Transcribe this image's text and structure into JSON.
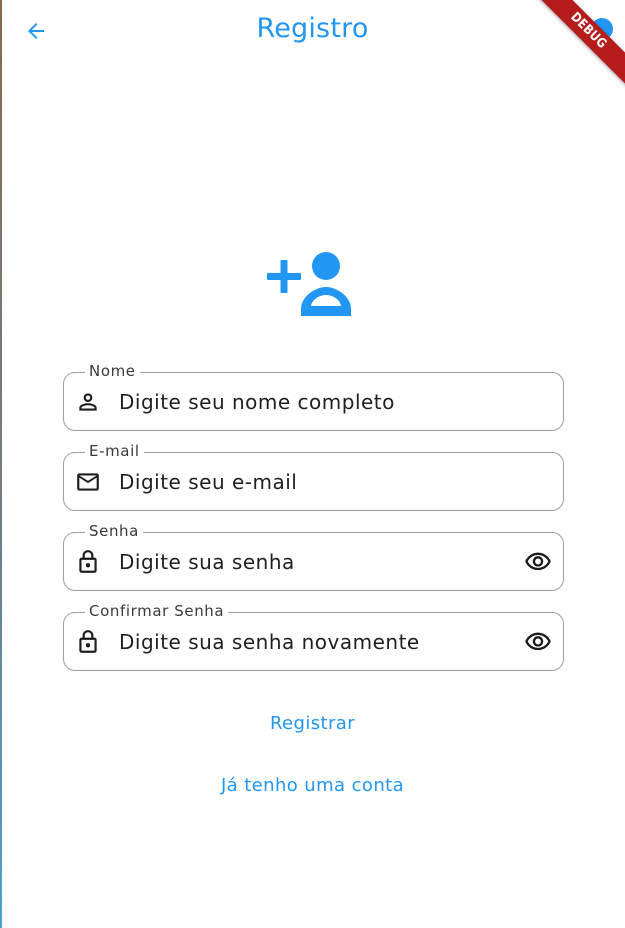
{
  "appbar": {
    "title": "Registro",
    "back_icon": "arrow-back-icon"
  },
  "debug_banner": "DEBUG",
  "hero_icon": "person-add-icon",
  "form": {
    "fields": [
      {
        "label": "Nome",
        "placeholder": "Digite seu nome completo",
        "icon": "person-icon",
        "value": ""
      },
      {
        "label": "E-mail",
        "placeholder": "Digite seu e-mail",
        "icon": "mail-icon",
        "value": ""
      },
      {
        "label": "Senha",
        "placeholder": "Digite sua senha",
        "icon": "lock-icon",
        "trailing_icon": "eye-icon",
        "value": ""
      },
      {
        "label": "Confirmar Senha",
        "placeholder": "Digite sua senha novamente",
        "icon": "lock-icon",
        "trailing_icon": "eye-icon",
        "value": ""
      }
    ]
  },
  "actions": {
    "register_label": "Registrar",
    "login_label": "Já tenho uma conta"
  },
  "colors": {
    "accent": "#2196f3",
    "border": "#9e9e9e",
    "debug": "#b71c1c"
  }
}
